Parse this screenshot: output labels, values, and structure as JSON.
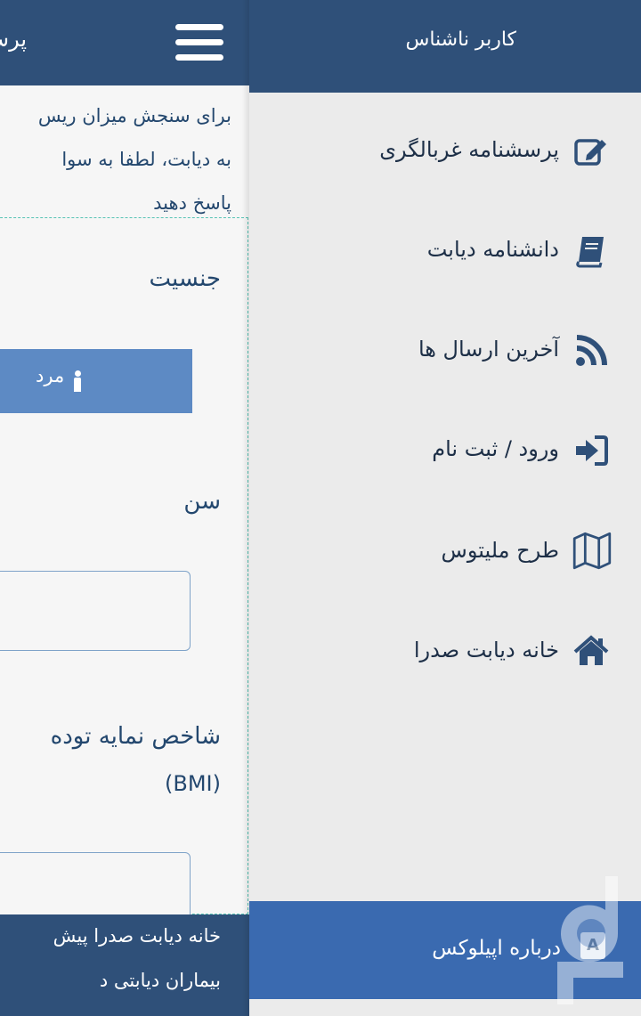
{
  "main": {
    "title": "پرس",
    "intro_lines": [
      "برای سنجش میزان ریس",
      "به دیابت، لطفا به سوا",
      "پاسخ دهید"
    ],
    "gender": {
      "label": "جنسیت",
      "option_male": "مرد"
    },
    "age": {
      "label": "سن",
      "value": ""
    },
    "bmi": {
      "label": "شاخص نمایه توده",
      "unit": "(BMI)",
      "value": ""
    },
    "footer": {
      "line1": "خانه دیابت صدرا پیش",
      "line2": "بیماران دیابتی د"
    }
  },
  "drawer": {
    "user": "کاربر ناشناس",
    "items": [
      {
        "label": "پرسشنامه غربالگری",
        "icon": "edit-icon"
      },
      {
        "label": "دانشنامه دیابت",
        "icon": "book-icon"
      },
      {
        "label": "آخرین ارسال ها",
        "icon": "rss-icon"
      },
      {
        "label": "ورود / ثبت نام",
        "icon": "sign-in-icon"
      },
      {
        "label": "طرح ملیتوس",
        "icon": "map-icon"
      },
      {
        "label": "خانه دیابت صدرا",
        "icon": "home-icon"
      }
    ],
    "about": {
      "label": "درباره اپیلوکس",
      "icon_letter": "A"
    }
  },
  "colors": {
    "header": "#2f5079",
    "accent": "#5d8ac4",
    "drawer_bg": "#ebebeb",
    "about_bg": "#3a6ab0",
    "dashed_border": "#56c3b4"
  }
}
